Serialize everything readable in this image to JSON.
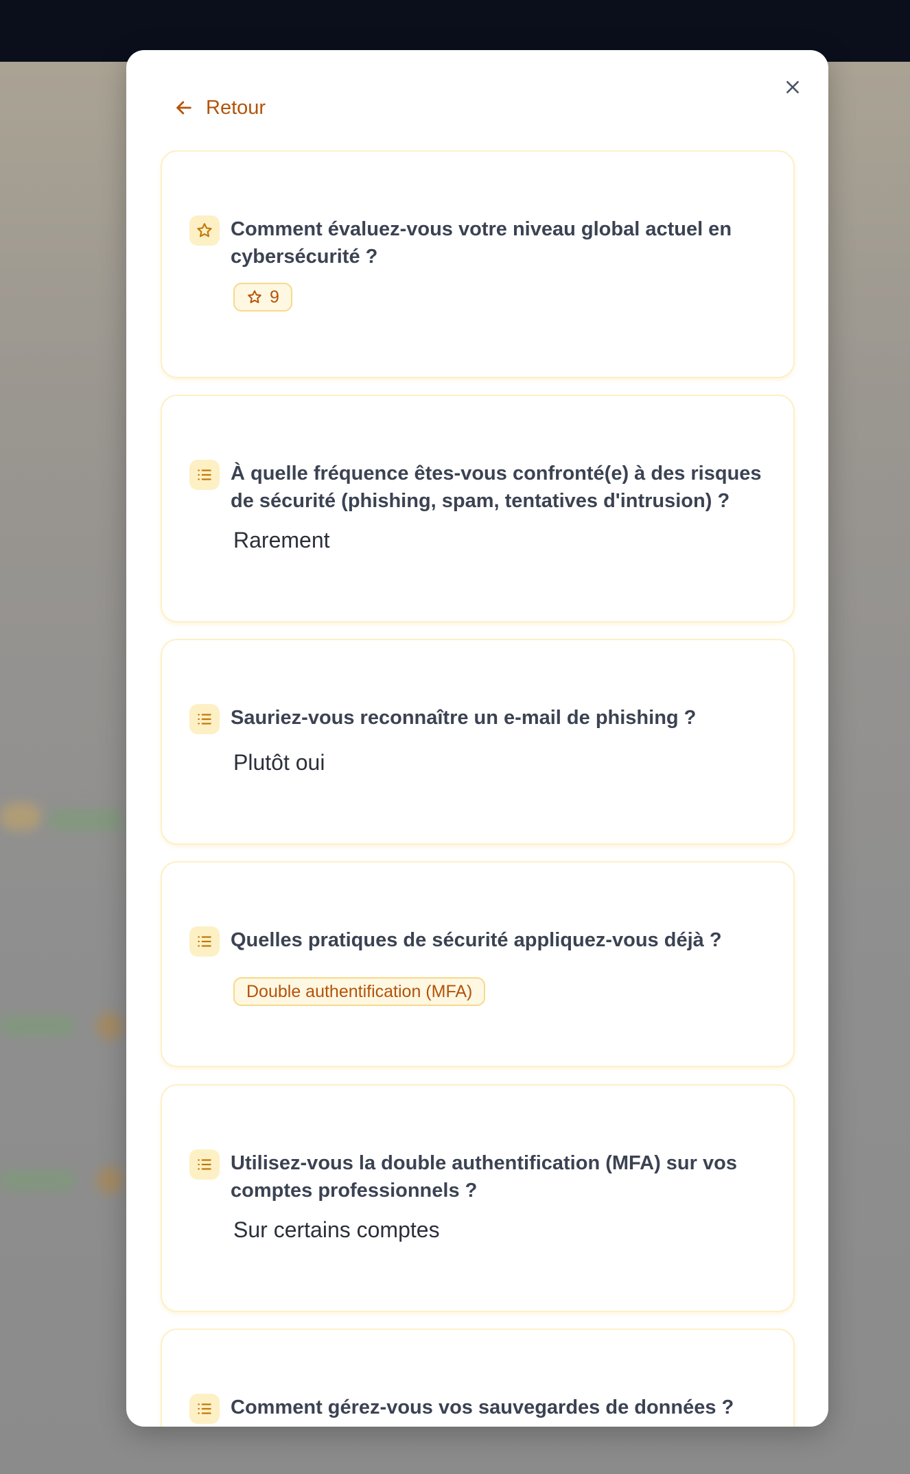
{
  "modal": {
    "back_label": "Retour"
  },
  "questions": [
    {
      "text": "Comment évaluez-vous votre niveau global actuel en cybersécurité ?",
      "icon": "star-icon",
      "rating": "9"
    },
    {
      "text": "À quelle fréquence êtes-vous confronté(e) à des risques de sécurité (phishing, spam, tentatives d'intrusion) ?",
      "icon": "list-icon",
      "answer": "Rarement"
    },
    {
      "text": "Sauriez-vous reconnaître un e-mail de phishing ?",
      "icon": "list-icon",
      "answer": "Plutôt oui"
    },
    {
      "text": "Quelles pratiques de sécurité appliquez-vous déjà ?",
      "icon": "list-icon",
      "tag": "Double authentification (MFA)"
    },
    {
      "text": "Utilisez-vous la double authentification (MFA) sur vos comptes professionnels ?",
      "icon": "list-icon",
      "answer": "Sur certains comptes"
    },
    {
      "text": "Comment gérez-vous vos sauvegardes de données ?",
      "icon": "list-icon"
    }
  ],
  "colors": {
    "accent": "#b45309",
    "card_border": "#fdf0c8",
    "icon_bg": "#fdf0c4",
    "question_text": "#3b4252"
  }
}
